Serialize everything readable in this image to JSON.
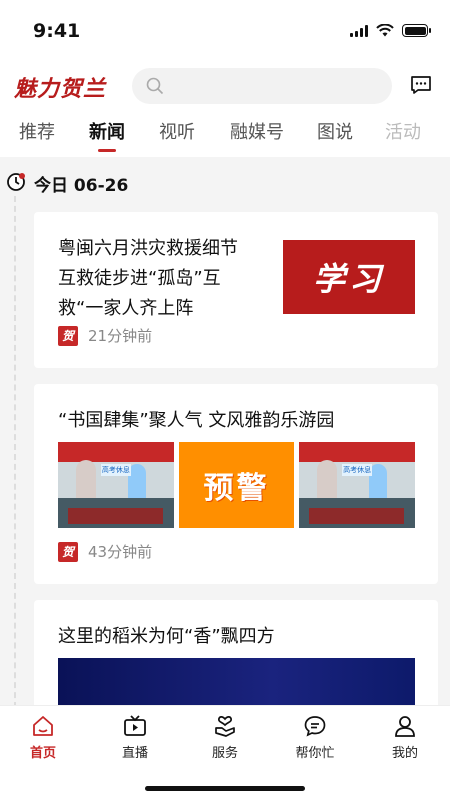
{
  "status_bar": {
    "time": "9:41"
  },
  "header": {
    "logo_text": "魅力贺兰",
    "search_icon": "search-icon",
    "message_icon": "message-icon"
  },
  "tabs": [
    {
      "label": "推荐"
    },
    {
      "label": "新闻",
      "active": true
    },
    {
      "label": "视听"
    },
    {
      "label": "融媒号"
    },
    {
      "label": "图说"
    },
    {
      "label": "活动"
    }
  ],
  "date_label": "今日 06-26",
  "articles": [
    {
      "title": "粤闽六月洪灾救援细节 互救徒步进“孤岛”互救“一家人齐上阵",
      "thumbnail_text": "学习",
      "source_mark": "贺",
      "time_ago": "21分钟前"
    },
    {
      "title": "“书国肆集”聚人气 文风雅韵乐游园",
      "middle_image_text": "预警",
      "photo_board_text": "高考休息",
      "source_mark": "贺",
      "time_ago": "43分钟前"
    },
    {
      "title": "这里的稻米为何“香”飘四方"
    }
  ],
  "bottom_nav": [
    {
      "label": "首页",
      "icon": "home-icon",
      "active": true
    },
    {
      "label": "直播",
      "icon": "tv-icon"
    },
    {
      "label": "服务",
      "icon": "heart-hand-icon"
    },
    {
      "label": "帮你忙",
      "icon": "chat-bubble-icon"
    },
    {
      "label": "我的",
      "icon": "user-icon"
    }
  ],
  "colors": {
    "accent": "#c62828",
    "warning": "#ff8f00"
  }
}
